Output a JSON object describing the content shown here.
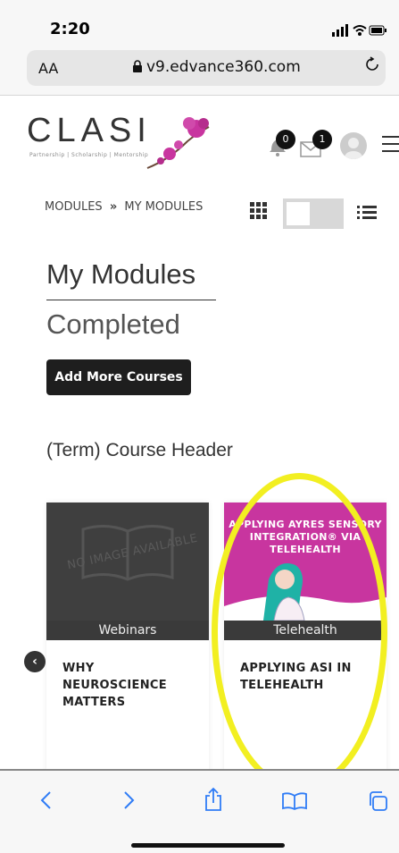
{
  "status": {
    "time": "2:20"
  },
  "browser": {
    "text_size_label": "AA",
    "url": "v9.edvance360.com"
  },
  "header": {
    "logo_text": "CLASI",
    "tagline": "Partnership | Scholarship | Mentorship",
    "notifications_count": "0",
    "messages_count": "1"
  },
  "breadcrumb": {
    "parent": "MODULES",
    "separator": "»",
    "current": "MY MODULES"
  },
  "page": {
    "title": "My Modules",
    "subtitle": "Completed",
    "add_button": "Add More Courses",
    "section_header": "(Term) Course Header"
  },
  "courses": [
    {
      "image_text": "NO IMAGE AVAILABLE",
      "category": "Webinars",
      "title": "WHY NEUROSCIENCE MATTERS"
    },
    {
      "image_text": "APPLYING AYRES SENSORY INTEGRATION® VIA TELEHEALTH",
      "category": "Telehealth",
      "title": "APPLYING ASI IN TELEHEALTH"
    }
  ],
  "colors": {
    "accent": "#c8359f",
    "highlight": "#f2ef21",
    "ios_blue": "#2f7cf6",
    "dark": "#1e1e1e"
  },
  "icons": [
    "signal-icon",
    "wifi-icon",
    "battery-icon",
    "lock-icon",
    "reload-icon",
    "bell-icon",
    "envelope-icon",
    "grid-view-icon",
    "list-view-icon",
    "back-icon",
    "forward-icon",
    "share-icon",
    "bookmarks-icon",
    "tabs-icon"
  ]
}
